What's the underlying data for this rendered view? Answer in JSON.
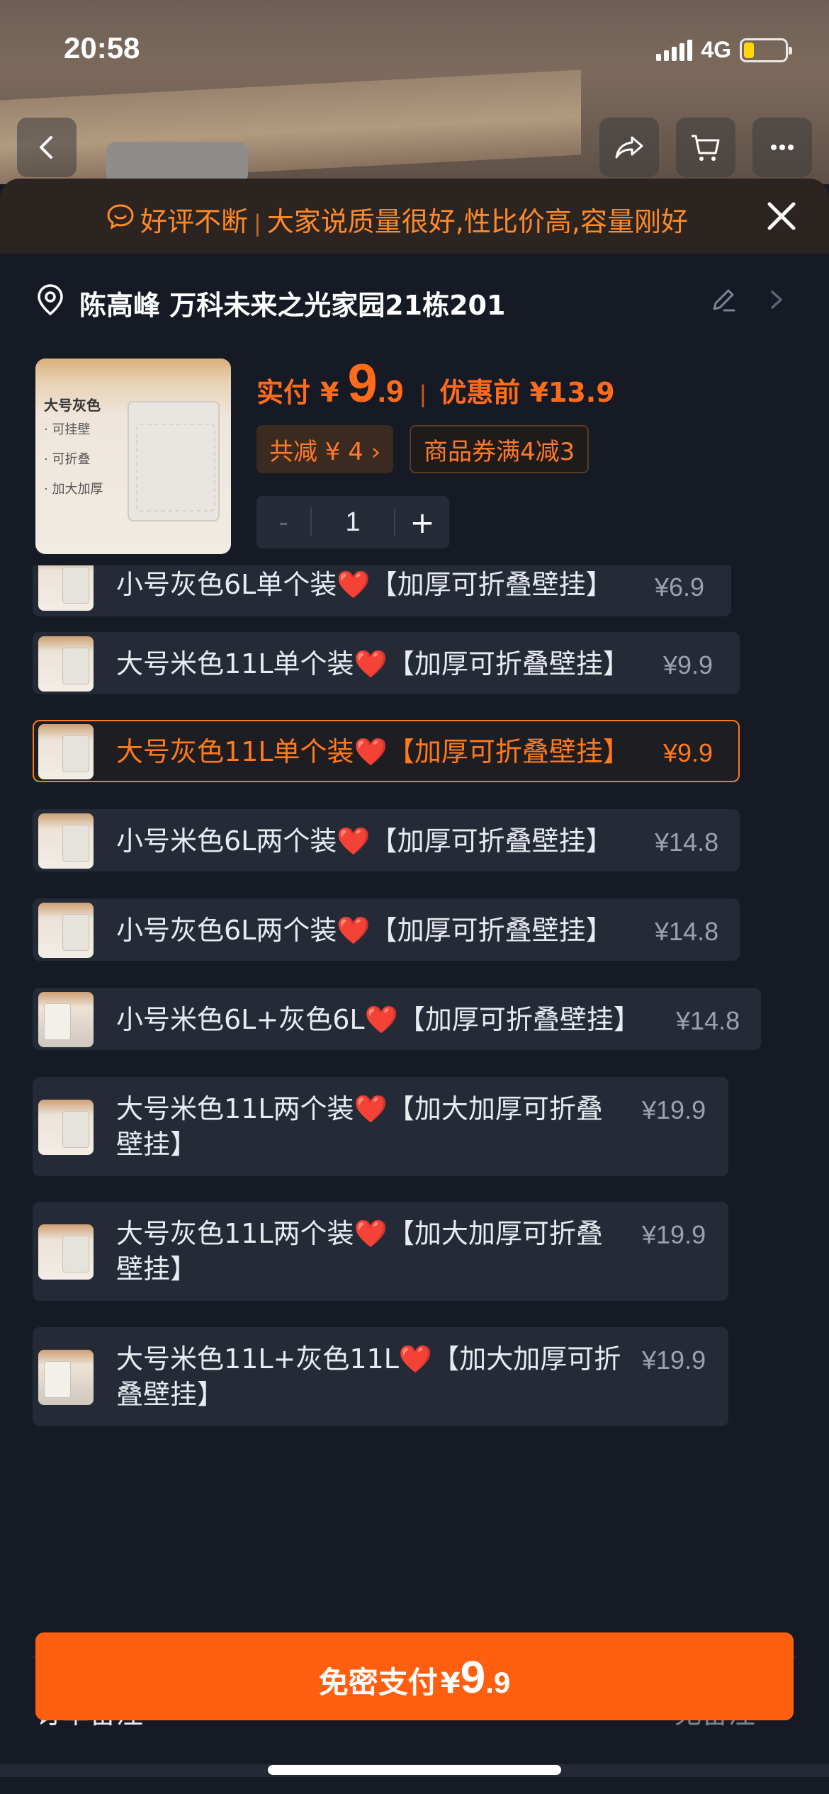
{
  "status": {
    "time": "20:58",
    "network": "4G",
    "battery_level": 0.25,
    "battery_color": "#ffd60a"
  },
  "banner": {
    "tag": "好评不断",
    "text": "大家说质量很好,性比价高,容量刚好"
  },
  "address": {
    "text": "陈高峰 万科未来之光家园21栋201"
  },
  "product": {
    "thumb_title": "大号灰色",
    "thumb_features": [
      "· 可挂壁",
      "· 可折叠",
      "· 加大加厚"
    ],
    "price_label": "实付",
    "price_yen": "¥",
    "price_int": "9",
    "price_dec": ".9",
    "price_before": "优惠前 ¥13.9",
    "discount_chip": "共减 ¥ 4 ›",
    "coupon_chip": "商品券满4减3",
    "quantity": "1",
    "minus": "-",
    "plus": "+"
  },
  "options": [
    {
      "label": "小号灰色6L单个装❤️【加厚可折叠壁挂】",
      "price": "¥6.9",
      "selected": false
    },
    {
      "label": "大号米色11L单个装❤️【加厚可折叠壁挂】",
      "price": "¥9.9",
      "selected": false
    },
    {
      "label": "大号灰色11L单个装❤️【加厚可折叠壁挂】",
      "price": "¥9.9",
      "selected": true
    },
    {
      "label": "小号米色6L两个装❤️【加厚可折叠壁挂】",
      "price": "¥14.8",
      "selected": false
    },
    {
      "label": "小号灰色6L两个装❤️【加厚可折叠壁挂】",
      "price": "¥14.8",
      "selected": false
    },
    {
      "label": "小号米色6L+灰色6L❤️【加厚可折叠壁挂】",
      "price": "¥14.8",
      "selected": false
    },
    {
      "label_line1": "大号米色11L两个装❤️【加大加厚可折叠",
      "label_line2": "壁挂】",
      "price": "¥19.9",
      "selected": false
    },
    {
      "label_line1": "大号灰色11L两个装❤️【加大加厚可折叠",
      "label_line2": "壁挂】",
      "price": "¥19.9",
      "selected": false
    },
    {
      "label_line1": "大号米色11L+灰色11L❤️【加大加厚可折",
      "label_line2": "叠壁挂】",
      "price": "¥19.9",
      "selected": false
    }
  ],
  "remark": {
    "label": "订单备注",
    "value": "无备注"
  },
  "pay": {
    "label": "免密支付",
    "yen": "¥",
    "int": "9",
    "dec": ".9"
  },
  "colors": {
    "accent": "#ff5f0f",
    "selected_border": "#ff7a1a",
    "background": "#151a24"
  }
}
